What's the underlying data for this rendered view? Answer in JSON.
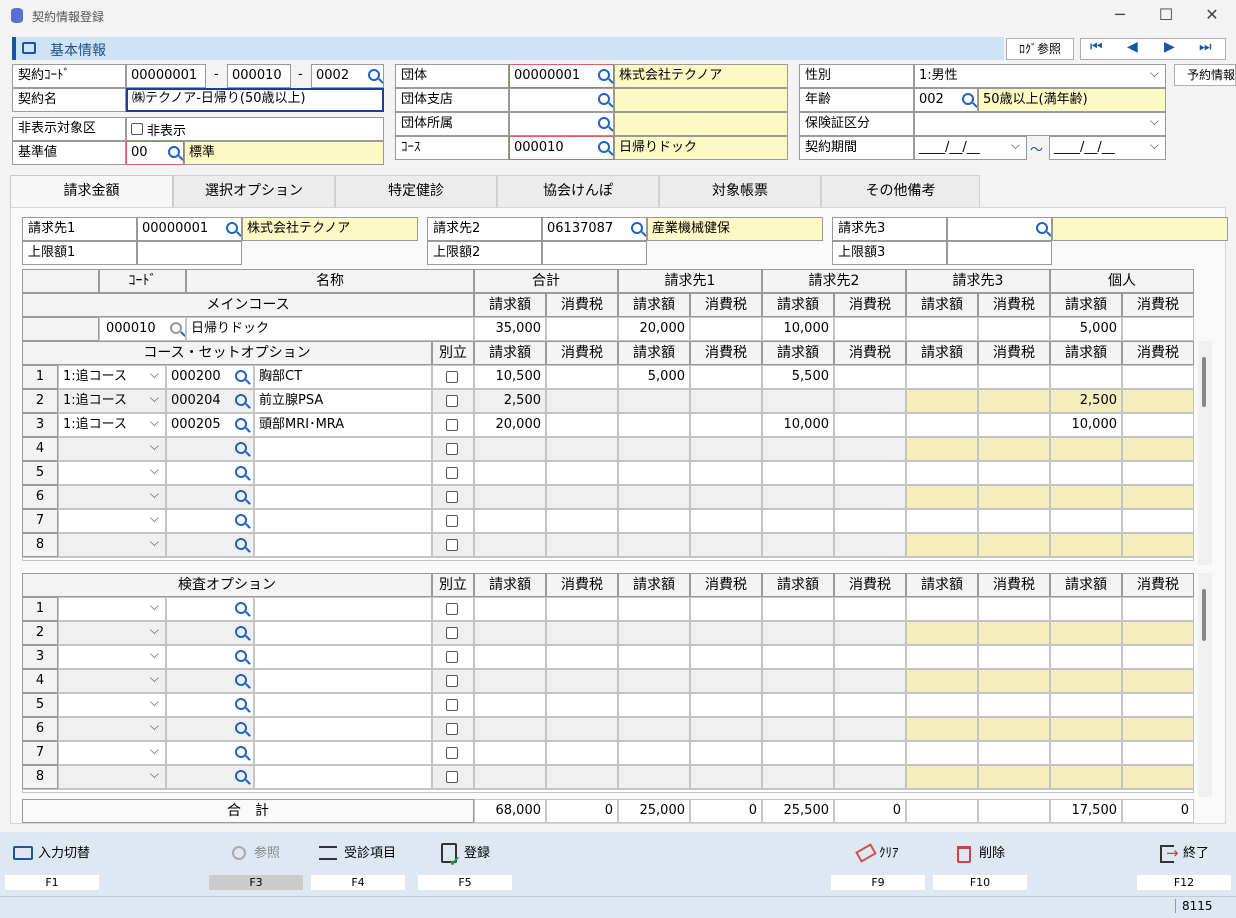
{
  "window": {
    "title": "契約情報登録",
    "minimize": "─",
    "maximize": "☐",
    "close": "✕"
  },
  "section": {
    "title": "基本情報",
    "log_button": "ﾛｸﾞ参照",
    "nav": [
      "⏮",
      "◀",
      "▶",
      "⏭"
    ],
    "reserve_button": "予約情報"
  },
  "header": {
    "contract_code_label": "契約ｺｰﾄﾞ",
    "contract_code_1": "00000001",
    "contract_code_2": "000010",
    "contract_code_3": "0002",
    "dash": "-",
    "contract_name_label": "契約名",
    "contract_name": "㈱テクノア-日帰り(50歳以上)",
    "hidden_label": "非表示対象区",
    "hidden_checkbox": "非表示",
    "standard_label": "基準値",
    "standard_code": "00",
    "standard_name": "標準",
    "group_label": "団体",
    "group_code": "00000001",
    "group_name": "株式会社テクノア",
    "branch_label": "団体支店",
    "affiliation_label": "団体所属",
    "course_label": "ｺｰｽ",
    "course_code": "000010",
    "course_name": "日帰りドック",
    "gender_label": "性別",
    "gender_value": "1:男性",
    "age_label": "年齢",
    "age_code": "002",
    "age_name": "50歳以上(満年齢)",
    "insurance_label": "保険証区分",
    "insurance_value": "",
    "period_label": "契約期間",
    "period_from": "____/__/__",
    "period_tilde": "～",
    "period_to": "____/__/__"
  },
  "tabs": [
    "請求金額",
    "選択オプション",
    "特定健診",
    "協会けんぽ",
    "対象帳票",
    "その他備考"
  ],
  "billing": {
    "b1_label": "請求先1",
    "b1_code": "00000001",
    "b1_name": "株式会社テクノア",
    "limit1_label": "上限額1",
    "b2_label": "請求先2",
    "b2_code": "06137087",
    "b2_name": "産業機械健保",
    "limit2_label": "上限額2",
    "b3_label": "請求先3",
    "b3_code": "",
    "b3_name": "",
    "limit3_label": "上限額3"
  },
  "grid": {
    "code_hdr": "ｺｰﾄﾞ",
    "name_hdr": "名称",
    "total_hdr": "合計",
    "b1_hdr": "請求先1",
    "b2_hdr": "請求先2",
    "b3_hdr": "請求先3",
    "person_hdr": "個人",
    "amount": "請求額",
    "tax": "消費税",
    "main_course_label": "メインコース",
    "main_code": "000010",
    "main_name": "日帰りドック",
    "main_values": [
      "35,000",
      "",
      "20,000",
      "",
      "10,000",
      "",
      "",
      "",
      "5,000",
      ""
    ],
    "set_option_label": "コース・セットオプション",
    "separate_label": "別立",
    "set_rows": [
      {
        "no": "1",
        "type": "1:追コース",
        "code": "000200",
        "name": "胸部CT",
        "values": [
          "10,500",
          "",
          "5,000",
          "",
          "5,500",
          "",
          "",
          "",
          "",
          ""
        ]
      },
      {
        "no": "2",
        "type": "1:追コース",
        "code": "000204",
        "name": "前立腺PSA",
        "values": [
          "2,500",
          "",
          "",
          "",
          "",
          "",
          "",
          "",
          "2,500",
          ""
        ]
      },
      {
        "no": "3",
        "type": "1:追コース",
        "code": "000205",
        "name": "頭部MRI･MRA",
        "values": [
          "20,000",
          "",
          "",
          "",
          "10,000",
          "",
          "",
          "",
          "10,000",
          ""
        ]
      },
      {
        "no": "4",
        "type": "",
        "code": "",
        "name": "",
        "values": [
          "",
          "",
          "",
          "",
          "",
          "",
          "",
          "",
          "",
          ""
        ]
      },
      {
        "no": "5",
        "type": "",
        "code": "",
        "name": "",
        "values": [
          "",
          "",
          "",
          "",
          "",
          "",
          "",
          "",
          "",
          ""
        ]
      },
      {
        "no": "6",
        "type": "",
        "code": "",
        "name": "",
        "values": [
          "",
          "",
          "",
          "",
          "",
          "",
          "",
          "",
          "",
          ""
        ]
      },
      {
        "no": "7",
        "type": "",
        "code": "",
        "name": "",
        "values": [
          "",
          "",
          "",
          "",
          "",
          "",
          "",
          "",
          "",
          ""
        ]
      },
      {
        "no": "8",
        "type": "",
        "code": "",
        "name": "",
        "values": [
          "",
          "",
          "",
          "",
          "",
          "",
          "",
          "",
          "",
          ""
        ]
      }
    ],
    "exam_option_label": "検査オプション",
    "exam_rows": [
      "1",
      "2",
      "3",
      "4",
      "5",
      "6",
      "7",
      "8"
    ],
    "total_label": "合　計",
    "totals": [
      "68,000",
      "0",
      "25,000",
      "0",
      "25,500",
      "0",
      "",
      "",
      "17,500",
      "0"
    ]
  },
  "fkeys": [
    {
      "label": "入力切替",
      "key": "F1"
    },
    {
      "label": "参照",
      "key": "F3"
    },
    {
      "label": "受診項目",
      "key": "F4"
    },
    {
      "label": "登録",
      "key": "F5"
    },
    {
      "label": "ｸﾘｱ",
      "key": "F9"
    },
    {
      "label": "削除",
      "key": "F10"
    },
    {
      "label": "終了",
      "key": "F12"
    }
  ],
  "status": {
    "code": "8115"
  }
}
